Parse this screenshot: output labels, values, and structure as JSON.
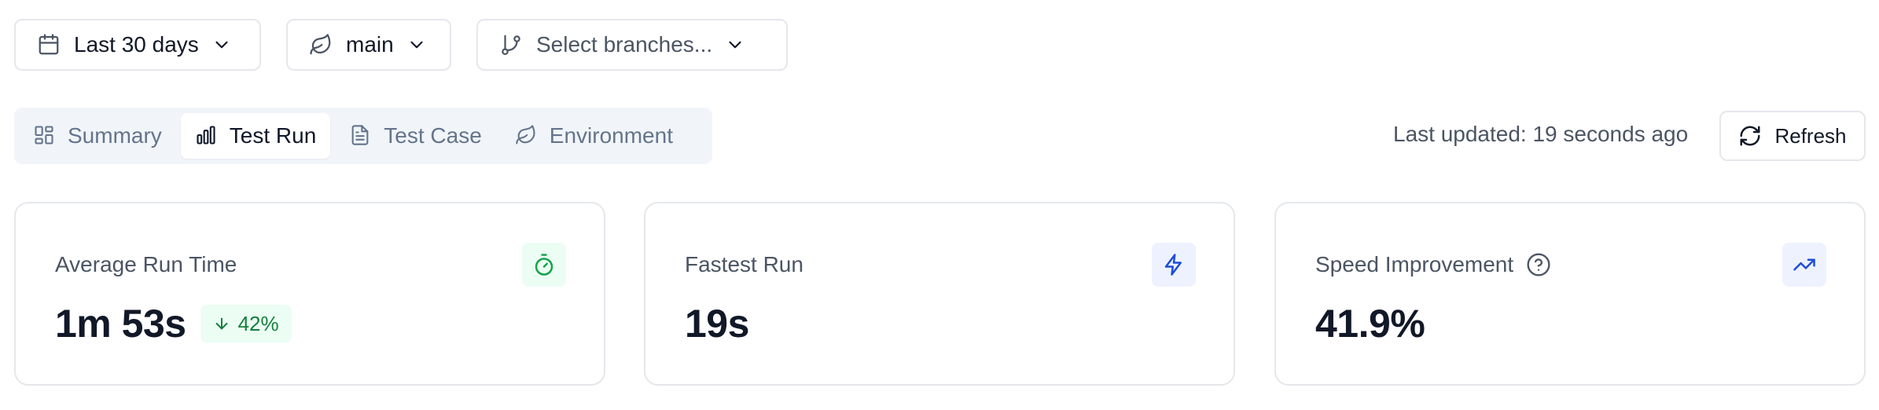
{
  "filters": {
    "date_range": "Last 30 days",
    "base_branch": "main",
    "branches_placeholder": "Select branches..."
  },
  "tabs": [
    {
      "label": "Summary",
      "icon": "layout-icon",
      "active": false
    },
    {
      "label": "Test Run",
      "icon": "bar-chart-icon",
      "active": true
    },
    {
      "label": "Test Case",
      "icon": "file-text-icon",
      "active": false
    },
    {
      "label": "Environment",
      "icon": "leaf-icon",
      "active": false
    }
  ],
  "status": {
    "last_updated": "Last updated: 19 seconds ago",
    "refresh_label": "Refresh"
  },
  "cards": [
    {
      "title": "Average Run Time",
      "value": "1m 53s",
      "delta": "42%",
      "delta_direction": "down",
      "icon": "stopwatch-icon",
      "accent": "#16a34a"
    },
    {
      "title": "Fastest Run",
      "value": "19s",
      "icon": "zap-icon",
      "accent": "#1d4ed8"
    },
    {
      "title": "Speed Improvement",
      "value": "41.9%",
      "icon": "trending-up-icon",
      "accent": "#1d4ed8",
      "has_help": true
    }
  ],
  "colors": {
    "border": "#e5e7eb",
    "tab_bar_bg": "#f1f5f9",
    "positive": "#16a34a",
    "info": "#1d4ed8"
  }
}
